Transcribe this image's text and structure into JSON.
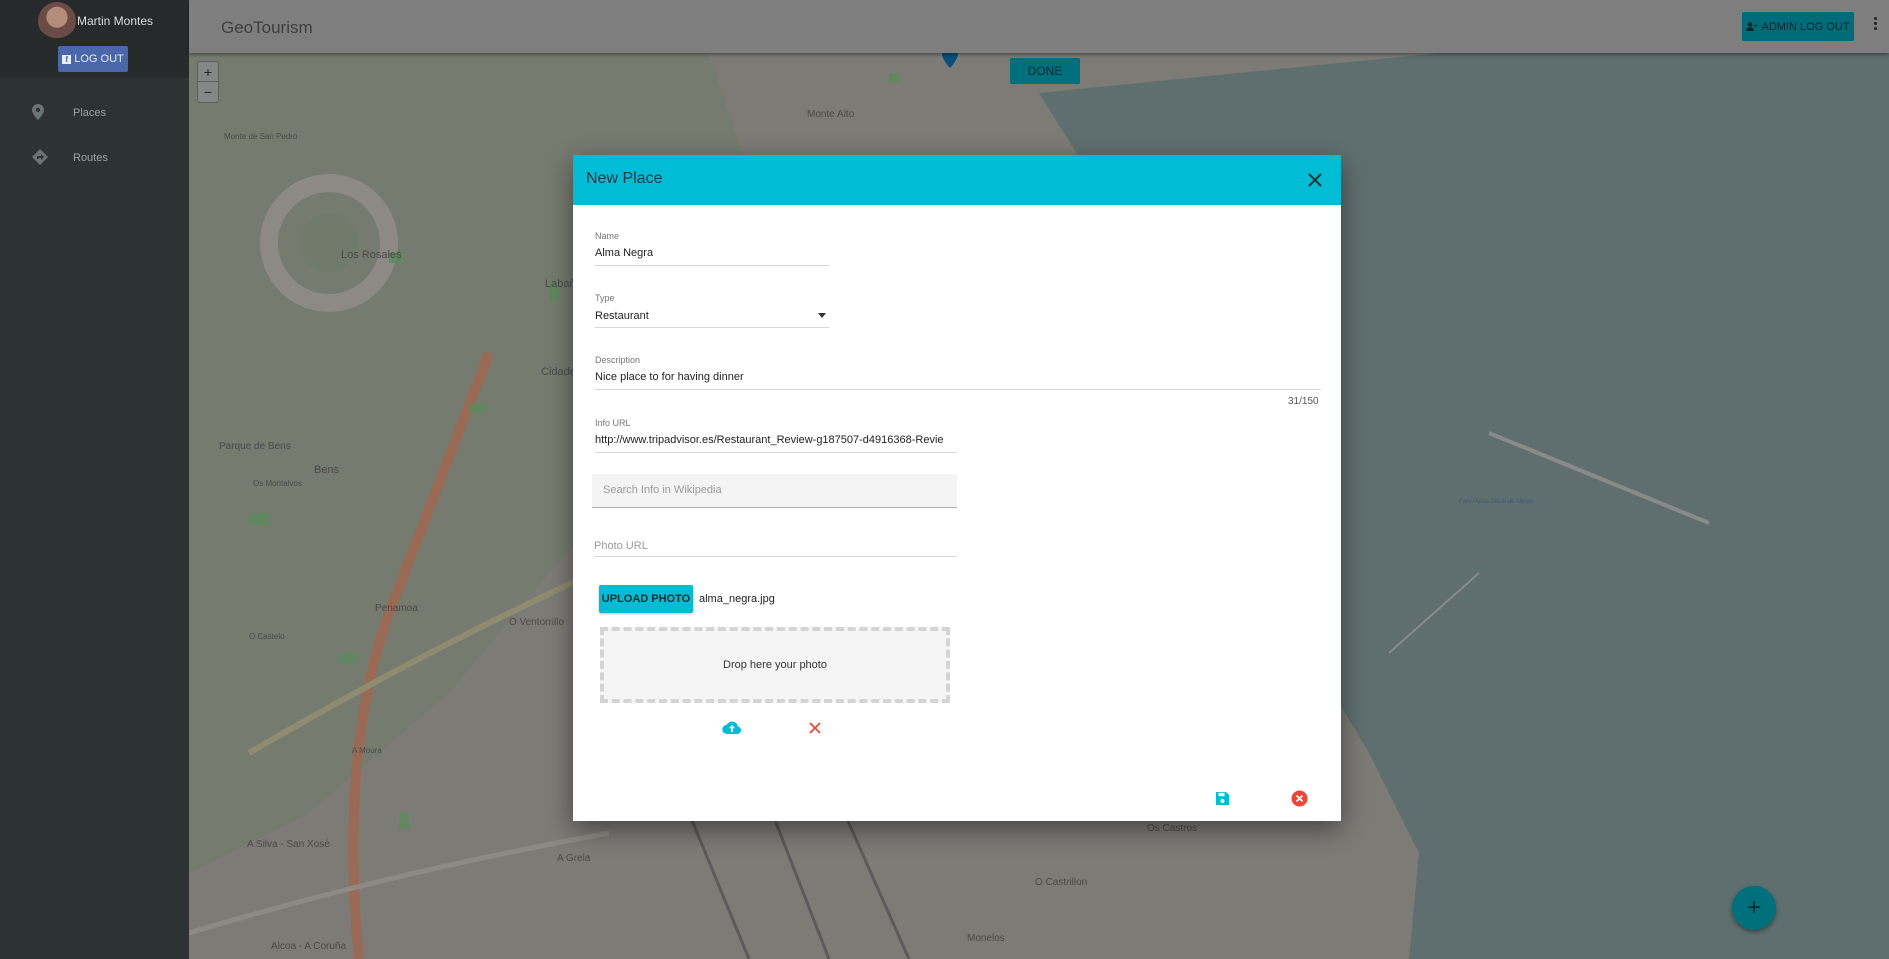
{
  "sidebar": {
    "user_name": "Martin Montes",
    "logout_label": "LOG OUT",
    "items": [
      {
        "label": "Places",
        "icon": "map-marker-icon"
      },
      {
        "label": "Routes",
        "icon": "directions-icon"
      }
    ]
  },
  "header": {
    "title": "GeoTourism",
    "admin_logout_label": "ADMIN LOG OUT"
  },
  "map": {
    "zoom_in": "+",
    "zoom_out": "−",
    "done_label": "DONE",
    "fab_label": "+",
    "labels": [
      "Monte Alto",
      "Los Rosales",
      "Bens",
      "Parque de Bens",
      "Penamoa",
      "O Ventorrillo",
      "A Grela",
      "Os Castros",
      "O Castrillon",
      "Monelos",
      "Alcoa - A Coruña",
      "A Silva - San Xosé",
      "Os Montalvos",
      "O Castelo",
      "Monte de San Pedro",
      "A Moura",
      "Cidade",
      "Labañ",
      "Faro Punta Dique de Abrigo"
    ]
  },
  "dialog": {
    "title": "New Place",
    "name": {
      "label": "Name",
      "value": "Alma Negra"
    },
    "type": {
      "label": "Type",
      "value": "Restaurant"
    },
    "description": {
      "label": "Description",
      "value_parts": [
        "Nice",
        " place to ",
        "for",
        " ",
        "having",
        " dinner"
      ],
      "counter": "31/150"
    },
    "info_url": {
      "label": "Info URL",
      "value": "http://www.tripadvisor.es/Restaurant_Review-g187507-d4916368-Revie"
    },
    "wikipedia": {
      "placeholder": "Search Info in Wikipedia"
    },
    "photo_url": {
      "placeholder": "Photo URL"
    },
    "upload_label": "UPLOAD PHOTO",
    "file_name": "alma_negra.jpg",
    "drop_text": "Drop here your photo"
  },
  "colors": {
    "accent": "#00bcd4",
    "sidebar": "#2d3233",
    "danger": "#f44336",
    "facebook": "#4a67a9"
  }
}
